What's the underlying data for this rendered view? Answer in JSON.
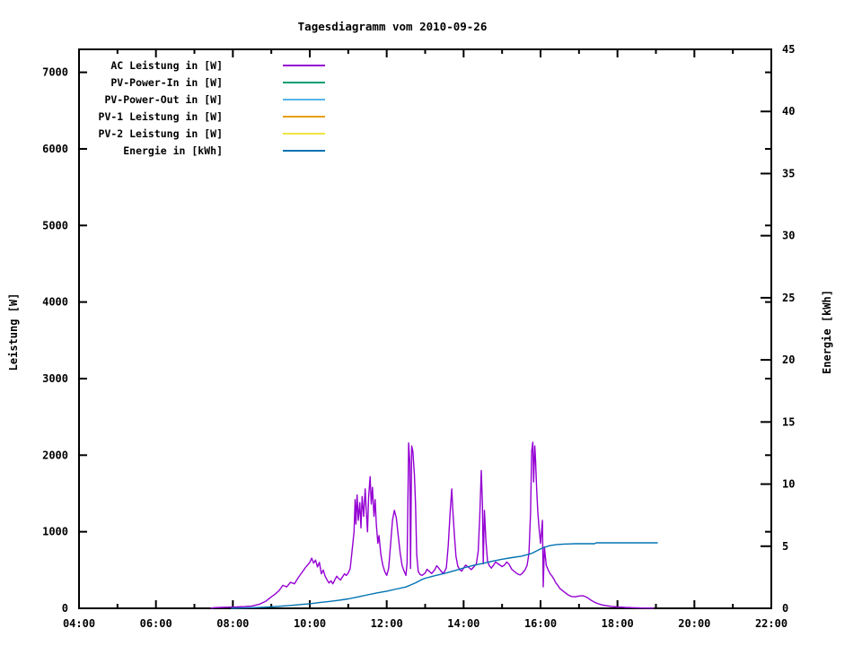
{
  "page": {
    "background": "#ffffff",
    "frame_color": "#000000"
  },
  "chart_data": {
    "type": "line",
    "title": "Tagesdiagramm vom 2010-09-26",
    "grid": false,
    "legend_position": "top-left-inside",
    "x_axis": {
      "range_hours": [
        4,
        22
      ],
      "major_tick_hours": [
        4,
        6,
        8,
        10,
        12,
        14,
        16,
        18,
        20,
        22
      ],
      "major_tick_labels": [
        "04:00",
        "06:00",
        "08:00",
        "10:00",
        "12:00",
        "14:00",
        "16:00",
        "18:00",
        "20:00",
        "22:00"
      ],
      "minor_tick_hours": [
        5,
        7,
        9,
        11,
        13,
        15,
        17,
        19,
        21
      ]
    },
    "y_axis_left": {
      "label": "Leistung [W]",
      "range": [
        0,
        7300
      ],
      "tick_values": [
        0,
        1000,
        2000,
        3000,
        4000,
        5000,
        6000,
        7000
      ],
      "tick_labels": [
        "0",
        "1000",
        "2000",
        "3000",
        "4000",
        "5000",
        "6000",
        "7000"
      ]
    },
    "y_axis_right": {
      "label": "Energie [kWh]",
      "range": [
        0,
        45
      ],
      "tick_values": [
        0,
        5,
        10,
        15,
        20,
        25,
        30,
        35,
        40,
        45
      ],
      "tick_labels": [
        "0",
        "5",
        "10",
        "15",
        "20",
        "25",
        "30",
        "35",
        "40",
        "45"
      ]
    },
    "legend": {
      "items": [
        {
          "label": "AC Leistung in [W]",
          "color": "#9400d3"
        },
        {
          "label": "PV-Power-In in [W]",
          "color": "#009e73"
        },
        {
          "label": "PV-Power-Out in [W]",
          "color": "#56b4e9"
        },
        {
          "label": "PV-1 Leistung in [W]",
          "color": "#e69f00"
        },
        {
          "label": "PV-2 Leistung in [W]",
          "color": "#f0e442"
        },
        {
          "label": "Energie in [kWh]",
          "color": "#0072b2"
        }
      ]
    },
    "series": [
      {
        "name": "AC Leistung in [W]",
        "color": "#9400d3",
        "axis": "left",
        "unit": "W",
        "visible": true,
        "points": [
          [
            7.42,
            0
          ],
          [
            7.5,
            8
          ],
          [
            7.7,
            12
          ],
          [
            7.9,
            15
          ],
          [
            8.1,
            18
          ],
          [
            8.3,
            22
          ],
          [
            8.5,
            30
          ],
          [
            8.7,
            55
          ],
          [
            8.85,
            90
          ],
          [
            9.0,
            150
          ],
          [
            9.1,
            185
          ],
          [
            9.2,
            230
          ],
          [
            9.3,
            300
          ],
          [
            9.4,
            280
          ],
          [
            9.5,
            340
          ],
          [
            9.6,
            320
          ],
          [
            9.7,
            400
          ],
          [
            9.8,
            470
          ],
          [
            9.9,
            540
          ],
          [
            10.0,
            600
          ],
          [
            10.05,
            655
          ],
          [
            10.1,
            590
          ],
          [
            10.15,
            630
          ],
          [
            10.2,
            540
          ],
          [
            10.25,
            600
          ],
          [
            10.3,
            450
          ],
          [
            10.35,
            500
          ],
          [
            10.4,
            420
          ],
          [
            10.45,
            370
          ],
          [
            10.5,
            330
          ],
          [
            10.55,
            360
          ],
          [
            10.6,
            320
          ],
          [
            10.65,
            370
          ],
          [
            10.7,
            420
          ],
          [
            10.75,
            390
          ],
          [
            10.8,
            370
          ],
          [
            10.85,
            410
          ],
          [
            10.9,
            450
          ],
          [
            10.95,
            430
          ],
          [
            11.0,
            460
          ],
          [
            11.05,
            520
          ],
          [
            11.1,
            750
          ],
          [
            11.15,
            1000
          ],
          [
            11.18,
            1420
          ],
          [
            11.2,
            1100
          ],
          [
            11.23,
            1480
          ],
          [
            11.26,
            1150
          ],
          [
            11.3,
            1380
          ],
          [
            11.33,
            1050
          ],
          [
            11.36,
            1460
          ],
          [
            11.4,
            1200
          ],
          [
            11.44,
            1560
          ],
          [
            11.47,
            1260
          ],
          [
            11.5,
            1000
          ],
          [
            11.53,
            1450
          ],
          [
            11.57,
            1720
          ],
          [
            11.6,
            1360
          ],
          [
            11.63,
            1580
          ],
          [
            11.67,
            1200
          ],
          [
            11.7,
            1420
          ],
          [
            11.73,
            1100
          ],
          [
            11.77,
            850
          ],
          [
            11.8,
            950
          ],
          [
            11.85,
            700
          ],
          [
            11.9,
            560
          ],
          [
            11.95,
            480
          ],
          [
            12.0,
            430
          ],
          [
            12.05,
            520
          ],
          [
            12.1,
            820
          ],
          [
            12.15,
            1150
          ],
          [
            12.2,
            1280
          ],
          [
            12.25,
            1180
          ],
          [
            12.3,
            950
          ],
          [
            12.35,
            720
          ],
          [
            12.4,
            560
          ],
          [
            12.45,
            490
          ],
          [
            12.5,
            430
          ],
          [
            12.53,
            600
          ],
          [
            12.57,
            2160
          ],
          [
            12.6,
            1900
          ],
          [
            12.62,
            520
          ],
          [
            12.65,
            2120
          ],
          [
            12.68,
            2050
          ],
          [
            12.72,
            1750
          ],
          [
            12.75,
            1350
          ],
          [
            12.78,
            700
          ],
          [
            12.82,
            480
          ],
          [
            12.87,
            440
          ],
          [
            12.92,
            430
          ],
          [
            13.0,
            460
          ],
          [
            13.05,
            510
          ],
          [
            13.1,
            485
          ],
          [
            13.17,
            455
          ],
          [
            13.25,
            505
          ],
          [
            13.3,
            555
          ],
          [
            13.37,
            515
          ],
          [
            13.45,
            460
          ],
          [
            13.5,
            475
          ],
          [
            13.55,
            530
          ],
          [
            13.6,
            820
          ],
          [
            13.65,
            1250
          ],
          [
            13.69,
            1560
          ],
          [
            13.72,
            1280
          ],
          [
            13.76,
            950
          ],
          [
            13.8,
            680
          ],
          [
            13.85,
            550
          ],
          [
            13.9,
            505
          ],
          [
            13.95,
            485
          ],
          [
            14.0,
            525
          ],
          [
            14.05,
            565
          ],
          [
            14.12,
            540
          ],
          [
            14.2,
            505
          ],
          [
            14.27,
            545
          ],
          [
            14.33,
            580
          ],
          [
            14.38,
            750
          ],
          [
            14.42,
            1200
          ],
          [
            14.46,
            1800
          ],
          [
            14.49,
            1350
          ],
          [
            14.51,
            580
          ],
          [
            14.54,
            1280
          ],
          [
            14.58,
            880
          ],
          [
            14.62,
            620
          ],
          [
            14.67,
            555
          ],
          [
            14.72,
            525
          ],
          [
            14.78,
            565
          ],
          [
            14.83,
            605
          ],
          [
            14.9,
            580
          ],
          [
            15.0,
            545
          ],
          [
            15.07,
            570
          ],
          [
            15.12,
            605
          ],
          [
            15.18,
            575
          ],
          [
            15.25,
            510
          ],
          [
            15.32,
            480
          ],
          [
            15.4,
            450
          ],
          [
            15.47,
            435
          ],
          [
            15.53,
            460
          ],
          [
            15.6,
            505
          ],
          [
            15.65,
            560
          ],
          [
            15.7,
            720
          ],
          [
            15.74,
            1250
          ],
          [
            15.77,
            2050
          ],
          [
            15.8,
            2170
          ],
          [
            15.82,
            1650
          ],
          [
            15.85,
            2120
          ],
          [
            15.87,
            1950
          ],
          [
            15.9,
            1550
          ],
          [
            15.93,
            1250
          ],
          [
            15.97,
            1000
          ],
          [
            16.0,
            850
          ],
          [
            16.05,
            1150
          ],
          [
            16.07,
            280
          ],
          [
            16.1,
            800
          ],
          [
            16.15,
            560
          ],
          [
            16.2,
            500
          ],
          [
            16.25,
            450
          ],
          [
            16.3,
            420
          ],
          [
            16.35,
            380
          ],
          [
            16.4,
            330
          ],
          [
            16.45,
            300
          ],
          [
            16.5,
            260
          ],
          [
            16.6,
            220
          ],
          [
            16.7,
            180
          ],
          [
            16.8,
            155
          ],
          [
            16.9,
            150
          ],
          [
            17.0,
            160
          ],
          [
            17.1,
            165
          ],
          [
            17.2,
            145
          ],
          [
            17.3,
            110
          ],
          [
            17.4,
            80
          ],
          [
            17.5,
            60
          ],
          [
            17.6,
            45
          ],
          [
            17.7,
            35
          ],
          [
            17.85,
            25
          ],
          [
            18.0,
            18
          ],
          [
            18.2,
            12
          ],
          [
            18.4,
            8
          ],
          [
            18.6,
            5
          ],
          [
            18.8,
            3
          ],
          [
            18.95,
            2
          ]
        ]
      },
      {
        "name": "PV-Power-In in [W]",
        "color": "#009e73",
        "axis": "left",
        "unit": "W",
        "visible": false,
        "points": []
      },
      {
        "name": "PV-Power-Out in [W]",
        "color": "#56b4e9",
        "axis": "left",
        "unit": "W",
        "visible": false,
        "points": []
      },
      {
        "name": "PV-1 Leistung in [W]",
        "color": "#e69f00",
        "axis": "left",
        "unit": "W",
        "visible": false,
        "points": []
      },
      {
        "name": "PV-2 Leistung in [W]",
        "color": "#f0e442",
        "axis": "left",
        "unit": "W",
        "visible": false,
        "points": []
      },
      {
        "name": "Energie in [kWh]",
        "color": "#0072b2",
        "axis": "right",
        "unit": "kWh",
        "visible": true,
        "points": [
          [
            7.95,
            0
          ],
          [
            8.2,
            0.02
          ],
          [
            8.5,
            0.05
          ],
          [
            8.8,
            0.09
          ],
          [
            9.0,
            0.12
          ],
          [
            9.25,
            0.17
          ],
          [
            9.5,
            0.23
          ],
          [
            9.75,
            0.3
          ],
          [
            10.0,
            0.37
          ],
          [
            10.25,
            0.46
          ],
          [
            10.5,
            0.55
          ],
          [
            10.75,
            0.64
          ],
          [
            11.0,
            0.76
          ],
          [
            11.25,
            0.92
          ],
          [
            11.5,
            1.08
          ],
          [
            11.75,
            1.24
          ],
          [
            12.0,
            1.38
          ],
          [
            12.25,
            1.55
          ],
          [
            12.5,
            1.72
          ],
          [
            12.6,
            1.85
          ],
          [
            12.75,
            2.05
          ],
          [
            12.9,
            2.3
          ],
          [
            13.0,
            2.42
          ],
          [
            13.25,
            2.62
          ],
          [
            13.5,
            2.8
          ],
          [
            13.75,
            3.02
          ],
          [
            14.0,
            3.25
          ],
          [
            14.25,
            3.45
          ],
          [
            14.5,
            3.62
          ],
          [
            14.75,
            3.8
          ],
          [
            15.0,
            3.95
          ],
          [
            15.25,
            4.08
          ],
          [
            15.5,
            4.2
          ],
          [
            15.75,
            4.4
          ],
          [
            15.9,
            4.62
          ],
          [
            16.0,
            4.78
          ],
          [
            16.1,
            4.92
          ],
          [
            16.25,
            5.05
          ],
          [
            16.4,
            5.12
          ],
          [
            16.6,
            5.17
          ],
          [
            16.9,
            5.2
          ],
          [
            17.4,
            5.2
          ],
          [
            17.45,
            5.27
          ],
          [
            19.05,
            5.27
          ]
        ]
      }
    ]
  }
}
